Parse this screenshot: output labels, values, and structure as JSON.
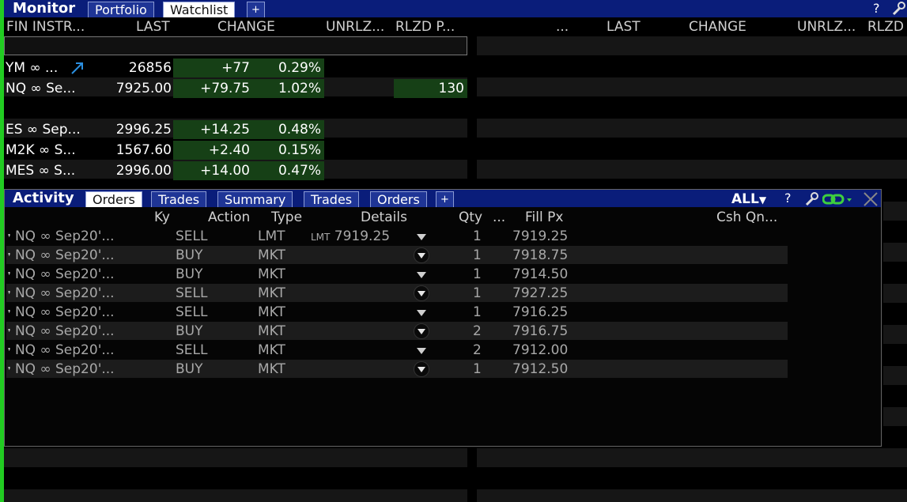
{
  "monitor": {
    "title": "Monitor",
    "tabs": [
      "Portfolio",
      "Watchlist",
      "+"
    ],
    "active_tab": "Watchlist",
    "icons": {
      "help": "?",
      "settings": "wrench-icon"
    }
  },
  "watchlist": {
    "columns_left": [
      "FIN INSTR...",
      "LAST",
      "CHANGE",
      "UNRLZ...",
      "RLZD P..."
    ],
    "columns_right": [
      "...",
      "LAST",
      "CHANGE",
      "UNRLZ...",
      "RLZD"
    ],
    "rows": [
      {
        "instr": "YM ∞ ...",
        "last": "26856",
        "change": "+77",
        "pct": "0.29%",
        "rlzd": "",
        "arrow": true
      },
      {
        "instr": "NQ ∞ Se...",
        "last": "7925.00",
        "change": "+79.75",
        "pct": "1.02%",
        "rlzd": "130",
        "arrow": false
      },
      {
        "instr": "",
        "last": "",
        "change": "",
        "pct": "",
        "rlzd": "",
        "arrow": false
      },
      {
        "instr": "ES ∞ Sep...",
        "last": "2996.25",
        "change": "+14.25",
        "pct": "0.48%",
        "rlzd": "",
        "arrow": false
      },
      {
        "instr": "M2K ∞ S...",
        "last": "1567.60",
        "change": "+2.40",
        "pct": "0.15%",
        "rlzd": "",
        "arrow": false
      },
      {
        "instr": "MES ∞ S...",
        "last": "2996.00",
        "change": "+14.00",
        "pct": "0.47%",
        "rlzd": "",
        "arrow": false
      }
    ]
  },
  "activity": {
    "title": "Activity",
    "tabs": [
      "Orders",
      "Trades",
      "Summary",
      "Trades",
      "Orders",
      "+"
    ],
    "active_tab_index": 0,
    "filter": "ALL",
    "icons": {
      "help": "?",
      "settings": "wrench-icon",
      "link": "link-icon",
      "close": "close-icon"
    },
    "columns": [
      "Ky",
      "Action",
      "Type",
      "Details",
      "Qty",
      "...",
      "Fill Px",
      "Csh Qn..."
    ],
    "orders": [
      {
        "instr": "NQ ∞ Sep20'...",
        "action": "SELL",
        "type": "LMT",
        "details_prefix": "LMT",
        "details": "7919.25",
        "qty": "1",
        "fill": "7919.25"
      },
      {
        "instr": "NQ ∞ Sep20'...",
        "action": "BUY",
        "type": "MKT",
        "details_prefix": "",
        "details": "",
        "qty": "1",
        "fill": "7918.75"
      },
      {
        "instr": "NQ ∞ Sep20'...",
        "action": "BUY",
        "type": "MKT",
        "details_prefix": "",
        "details": "",
        "qty": "1",
        "fill": "7914.50"
      },
      {
        "instr": "NQ ∞ Sep20'...",
        "action": "SELL",
        "type": "MKT",
        "details_prefix": "",
        "details": "",
        "qty": "1",
        "fill": "7927.25"
      },
      {
        "instr": "NQ ∞ Sep20'...",
        "action": "SELL",
        "type": "MKT",
        "details_prefix": "",
        "details": "",
        "qty": "1",
        "fill": "7916.25"
      },
      {
        "instr": "NQ ∞ Sep20'...",
        "action": "BUY",
        "type": "MKT",
        "details_prefix": "",
        "details": "",
        "qty": "2",
        "fill": "7916.75"
      },
      {
        "instr": "NQ ∞ Sep20'...",
        "action": "SELL",
        "type": "MKT",
        "details_prefix": "",
        "details": "",
        "qty": "2",
        "fill": "7912.00"
      },
      {
        "instr": "NQ ∞ Sep20'...",
        "action": "BUY",
        "type": "MKT",
        "details_prefix": "",
        "details": "",
        "qty": "1",
        "fill": "7912.50"
      }
    ]
  },
  "colors": {
    "header_blue": "#0a1d7a",
    "positive_green": "#164016",
    "accent_green": "#22cc22"
  }
}
